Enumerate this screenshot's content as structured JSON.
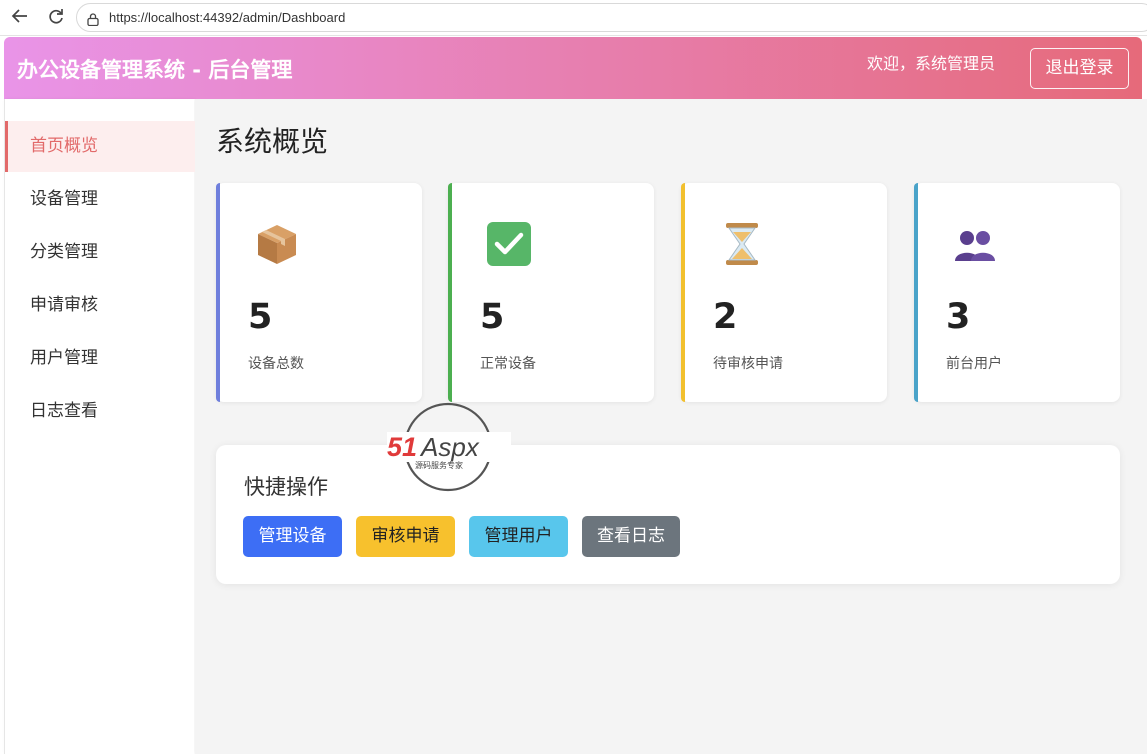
{
  "browser": {
    "url": "https://localhost:44392/admin/Dashboard"
  },
  "header": {
    "title": "办公设备管理系统 - 后台管理",
    "welcome": "欢迎，系统管理员",
    "logout_label": "退出登录",
    "gradient": [
      "#e994e8",
      "#e66a7a"
    ]
  },
  "sidebar": {
    "items": [
      {
        "label": "首页概览",
        "active": true
      },
      {
        "label": "设备管理",
        "active": false
      },
      {
        "label": "分类管理",
        "active": false
      },
      {
        "label": "申请审核",
        "active": false
      },
      {
        "label": "用户管理",
        "active": false
      },
      {
        "label": "日志查看",
        "active": false
      }
    ]
  },
  "main": {
    "title": "系统概览",
    "stats": [
      {
        "icon": "package-icon",
        "value": "5",
        "label": "设备总数",
        "color": "#6f7fdc"
      },
      {
        "icon": "checkmark-icon",
        "value": "5",
        "label": "正常设备",
        "color": "#4caf50"
      },
      {
        "icon": "hourglass-icon",
        "value": "2",
        "label": "待审核申请",
        "color": "#f2c02e"
      },
      {
        "icon": "users-icon",
        "value": "3",
        "label": "前台用户",
        "color": "#4aa3c9"
      }
    ],
    "quick_actions": {
      "title": "快捷操作",
      "buttons": [
        {
          "label": "管理设备",
          "color": "#3d6ef5",
          "text_color": "#ffffff"
        },
        {
          "label": "审核申请",
          "color": "#f7c12d",
          "text_color": "#222222"
        },
        {
          "label": "管理用户",
          "color": "#58c6ec",
          "text_color": "#222222"
        },
        {
          "label": "查看日志",
          "color": "#6c757d",
          "text_color": "#ffffff"
        }
      ]
    }
  },
  "watermark": {
    "brand": "51Aspx",
    "tagline": "源码服务专家"
  }
}
